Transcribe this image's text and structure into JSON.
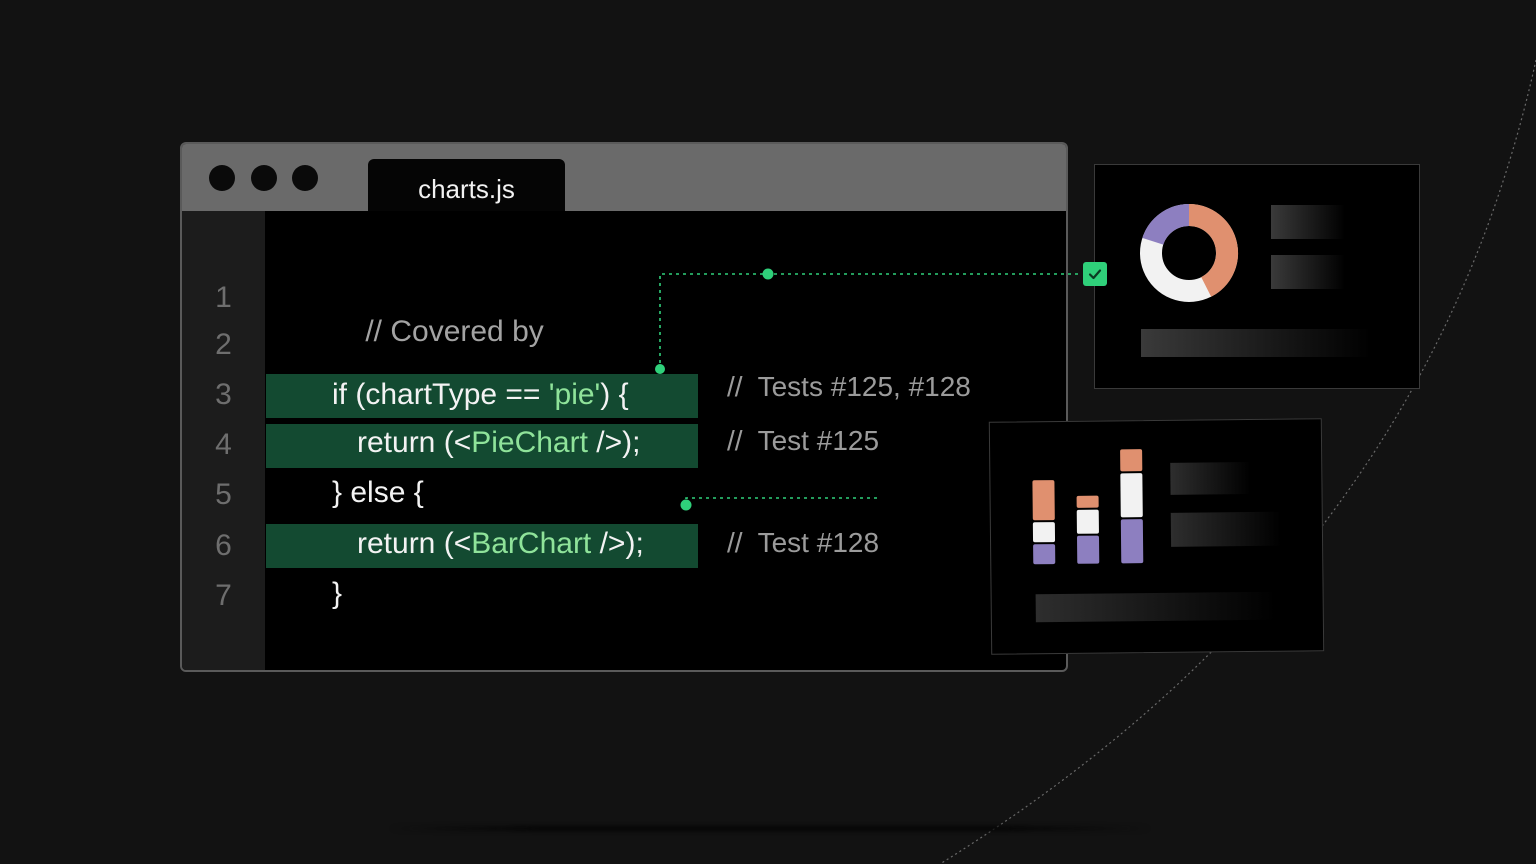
{
  "editor": {
    "tab_title": "charts.js",
    "lines": [
      {
        "number": "1",
        "text": "// Covered by",
        "highlighted": false
      },
      {
        "number": "2",
        "text": "",
        "highlighted": false
      },
      {
        "number": "3",
        "text": "if (chartType == 'pie') {",
        "highlighted": true
      },
      {
        "number": "4",
        "text": "return (<PieChart />);",
        "highlighted": true
      },
      {
        "number": "5",
        "text": "} else {",
        "highlighted": false
      },
      {
        "number": "6",
        "text": "return (<BarChart />);",
        "highlighted": true
      },
      {
        "number": "7",
        "text": "}",
        "highlighted": false
      }
    ],
    "code_parts": {
      "line3_a": "if (chartType == ",
      "line3_b": "'pie'",
      "line3_c": ") {",
      "line4_a": "return (<",
      "line4_b": "PieChart",
      "line4_c": " />);",
      "line6_a": "return (<",
      "line6_b": "BarChart",
      "line6_c": " />);"
    }
  },
  "annotations": {
    "line3": "//  Tests #125, #128",
    "line4": "//  Test #125",
    "line6": "//  Test #128"
  },
  "preview_cards": {
    "pie_card": {
      "checked": true,
      "icon": "check-icon"
    },
    "bar_card": {
      "icon": "bar-chart-icon"
    }
  },
  "colors": {
    "background": "#121212",
    "highlight": "#134a31",
    "accent_green": "#2fd07a",
    "string_green": "#8fe39a",
    "orange": "#e0906f",
    "purple": "#8d7fc0",
    "white": "#f2f2f2"
  },
  "icons": [
    "window-control-dot",
    "check-icon",
    "donut-chart-icon",
    "bar-chart-icon"
  ]
}
